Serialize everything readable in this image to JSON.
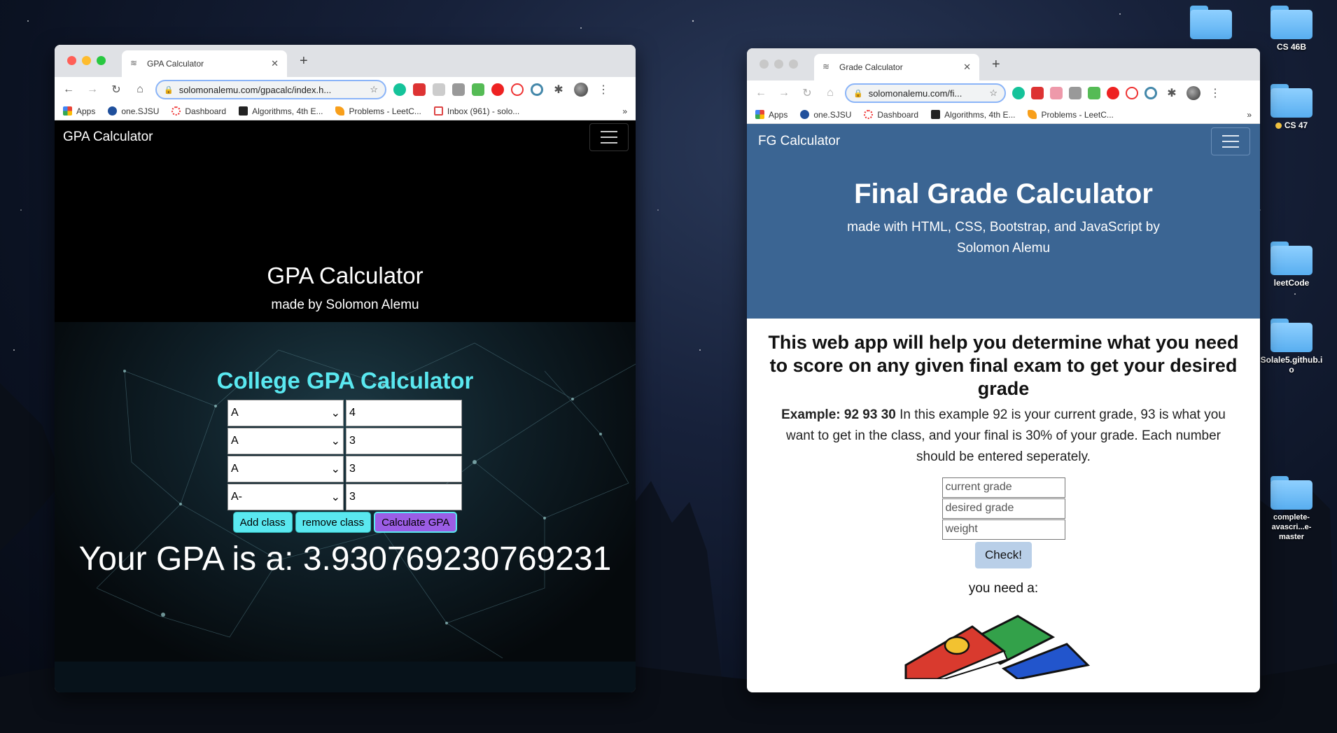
{
  "desktop": {
    "icons": [
      {
        "label": "CS 46B"
      },
      {
        "label": "CS 47"
      },
      {
        "label": "leetCode"
      },
      {
        "label": "Solale5.github.io"
      },
      {
        "label": "complete-\navascri...e-master"
      }
    ]
  },
  "left_window": {
    "tab_title": "GPA Calculator",
    "url": "solomonalemu.com/gpacalc/index.h...",
    "bookmarks": [
      "Apps",
      "one.SJSU",
      "Dashboard",
      "Algorithms, 4th E...",
      "Problems - LeetC...",
      "Inbox (961) - solo..."
    ],
    "bookmarks_more": "»",
    "page": {
      "brand": "GPA Calculator",
      "hero_title": "GPA Calculator",
      "hero_subtitle": "made by Solomon Alemu",
      "section_title": "College GPA Calculator",
      "rows": [
        {
          "grade": "A",
          "credits": "4"
        },
        {
          "grade": "A",
          "credits": "3"
        },
        {
          "grade": "A",
          "credits": "3"
        },
        {
          "grade": "A-",
          "credits": "3"
        }
      ],
      "buttons": {
        "add": "Add class",
        "remove": "remove class",
        "calculate": "Calculate GPA"
      },
      "result": "Your GPA is a: 3.930769230769231"
    }
  },
  "right_window": {
    "tab_title": "Grade Calculator",
    "url": "solomonalemu.com/fi...",
    "bookmarks": [
      "Apps",
      "one.SJSU",
      "Dashboard",
      "Algorithms, 4th E...",
      "Problems - LeetC..."
    ],
    "bookmarks_more": "»",
    "page": {
      "brand": "FG Calculator",
      "hero_title": "Final Grade Calculator",
      "hero_subtitle": "made with HTML, CSS, Bootstrap, and JavaScript by Solomon Alemu",
      "intro": "This web app will help you determine what you need to score on any given final exam to get your desired grade",
      "example_label": "Example: 92 93 30",
      "example_text": " In this example 92 is your current grade, 93 is what you want to get in the class, and your final is 30% of your grade. Each number should be entered seperately.",
      "inputs": {
        "current": "current grade",
        "desired": "desired grade",
        "weight": "weight"
      },
      "check": "Check!",
      "need": "you need a:"
    }
  },
  "colors": {
    "fg_blue": "#3b6593",
    "gpa_cyan": "#5ae8f0",
    "gpa_purple": "#9b5de5"
  }
}
